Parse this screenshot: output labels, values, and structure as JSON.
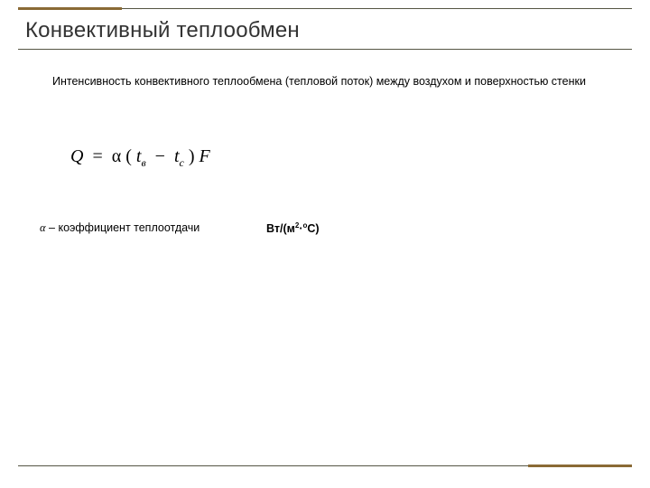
{
  "title": "Конвективный теплообмен",
  "intro": "Интенсивность конвективного теплообмена (тепловой поток) между воздухом и поверхностью стенки",
  "formula": {
    "Q": "Q",
    "eq": "=",
    "alpha": "α",
    "lpar": "(",
    "t1": "t",
    "sub1": "в",
    "minus": "−",
    "t2": "t",
    "sub2": "с",
    "rpar": ")",
    "F": "F"
  },
  "definition": {
    "alpha": "α",
    "text": " – коэффициент теплоотдачи"
  },
  "units": {
    "prefix": "Вт/(м",
    "sup1": "2",
    "mid": "·",
    "sup2": "о",
    "suffix": "С)"
  }
}
